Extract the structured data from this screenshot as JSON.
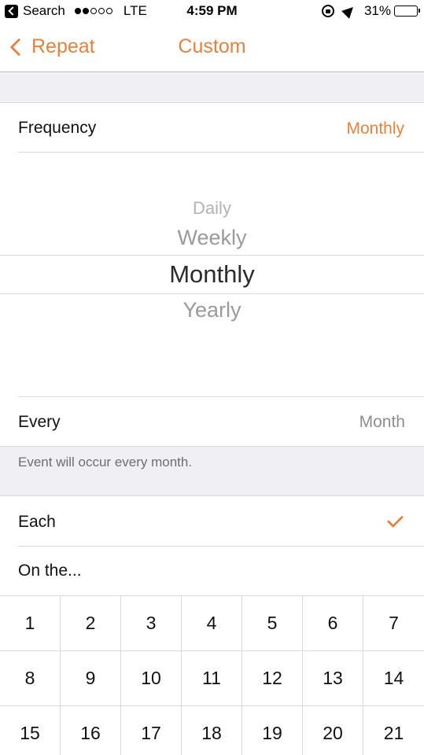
{
  "status_bar": {
    "carrier": "Search",
    "network": "LTE",
    "time": "4:59 PM",
    "battery": "31%",
    "battery_level": 0.31,
    "signal_bars_filled": 2,
    "signal_bars_total": 5
  },
  "nav": {
    "back_label": "Repeat",
    "title": "Custom"
  },
  "frequency": {
    "label": "Frequency",
    "value": "Monthly"
  },
  "picker": {
    "options": [
      "Daily",
      "Weekly",
      "Monthly",
      "Yearly"
    ],
    "selected": "Monthly"
  },
  "every": {
    "label": "Every",
    "value": "Month"
  },
  "note": "Event will occur every month.",
  "each": {
    "label": "Each",
    "checked": true
  },
  "on_the": {
    "label": "On the..."
  },
  "days": [
    "1",
    "2",
    "3",
    "4",
    "5",
    "6",
    "7",
    "8",
    "9",
    "10",
    "11",
    "12",
    "13",
    "14",
    "15",
    "16",
    "17",
    "18",
    "19",
    "20",
    "21"
  ],
  "colors": {
    "accent": "#e7813f",
    "group_background": "#efeff4",
    "separator": "#d9d9de",
    "secondary_text": "#8e8e93"
  }
}
